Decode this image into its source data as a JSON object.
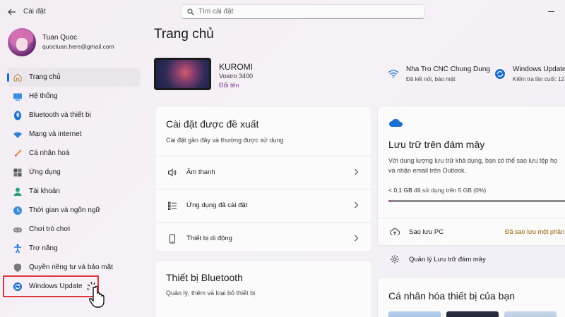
{
  "app": {
    "title": "Cài đặt"
  },
  "search": {
    "placeholder": "Tìm cài đặt"
  },
  "profile": {
    "name": "Tuan Quoc",
    "email": "quoctuan.here@gmail.com"
  },
  "sidebar": {
    "items": [
      {
        "label": "Trang chủ",
        "icon": "home-icon"
      },
      {
        "label": "Hệ thống",
        "icon": "system-icon"
      },
      {
        "label": "Bluetooth và thiết bị",
        "icon": "bluetooth-icon"
      },
      {
        "label": "Mạng và internet",
        "icon": "network-icon"
      },
      {
        "label": "Cá nhân hoá",
        "icon": "brush-icon"
      },
      {
        "label": "Ứng dụng",
        "icon": "apps-icon"
      },
      {
        "label": "Tài khoản",
        "icon": "account-icon"
      },
      {
        "label": "Thời gian và ngôn ngữ",
        "icon": "time-language-icon"
      },
      {
        "label": "Chơi trò chơi",
        "icon": "gamepad-icon"
      },
      {
        "label": "Trợ năng",
        "icon": "accessibility-icon"
      },
      {
        "label": "Quyền riêng tư và bảo mật",
        "icon": "shield-icon"
      },
      {
        "label": "Windows Update",
        "icon": "windows-update-icon"
      }
    ]
  },
  "main": {
    "title": "Trang chủ",
    "device": {
      "name": "KUROMI",
      "model": "Vostro 3400",
      "rename": "Đổi tên"
    },
    "wifi": {
      "title": "Nha Tro CNC Chung Dung",
      "status": "Đã kết nối, bảo mật"
    },
    "windows_update": {
      "title": "Windows Update",
      "status": "Kiểm tra lần cuối: 12"
    },
    "recommended": {
      "title": "Cài đặt được đề xuất",
      "subtitle": "Cài đặt gần đây và thường được sử dụng",
      "rows": [
        {
          "label": "Âm thanh",
          "icon": "speaker-icon"
        },
        {
          "label": "Ứng dụng đã cài đặt",
          "icon": "installed-apps-icon"
        },
        {
          "label": "Thiết bị di động",
          "icon": "phone-icon"
        }
      ]
    },
    "bluetooth": {
      "title": "Thiết bị Bluetooth",
      "subtitle": "Quản lý, thêm và loại bỏ thiết bị"
    },
    "cloud": {
      "title": "Lưu trữ trên đám mây",
      "description_line1": "Với dung lượng lưu trữ khả dụng, bạn có thể sao lưu tệp họ",
      "description_line2": "và nhận email trên Outlook.",
      "usage_value": "< 0,1 GB",
      "usage_text": "đã sử dụng trên 5 GB (0%)",
      "usage_fraction": 0.01,
      "backup_label": "Sao lưu PC",
      "backup_status": "Đã sao lưu một phần",
      "manage_label": "Quản lý Lưu trữ đám mây"
    },
    "personalize": {
      "title": "Cá nhân hóa thiết bị của bạn"
    }
  },
  "colors": {
    "accent": "#1a6fd1",
    "highlight": "#e0373b",
    "link": "#8a3a9e",
    "progress": "#c239b3",
    "warning": "#9d5d00"
  }
}
